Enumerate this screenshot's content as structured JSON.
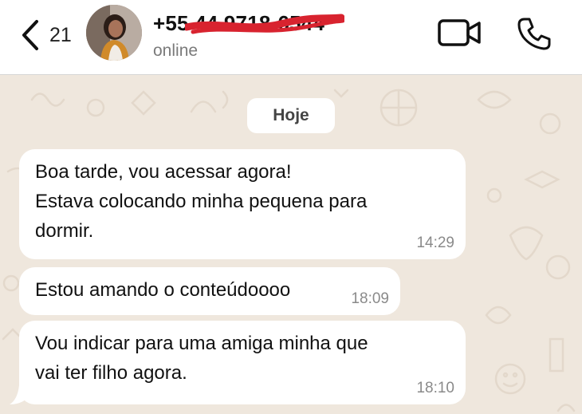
{
  "header": {
    "back_count": "21",
    "contact_name": "+55 44 9718-6544",
    "contact_status": "online"
  },
  "chat": {
    "date_label": "Hoje",
    "messages": [
      {
        "text": "Boa tarde, vou acessar agora!\nEstava colocando minha pequena para\ndormir.",
        "time": "14:29"
      },
      {
        "text": "Estou amando o conteúdoooo",
        "time": "18:09"
      },
      {
        "text": "Vou indicar para uma amiga minha que\nvai ter filho agora.",
        "time": "18:10"
      }
    ]
  },
  "colors": {
    "header_bg": "#ffffff",
    "chat_bg": "#efe7dd",
    "bubble_bg": "#ffffff",
    "redaction": "#d8232f"
  },
  "icons": [
    "chevron-left-icon",
    "video-camera-icon",
    "phone-icon"
  ]
}
